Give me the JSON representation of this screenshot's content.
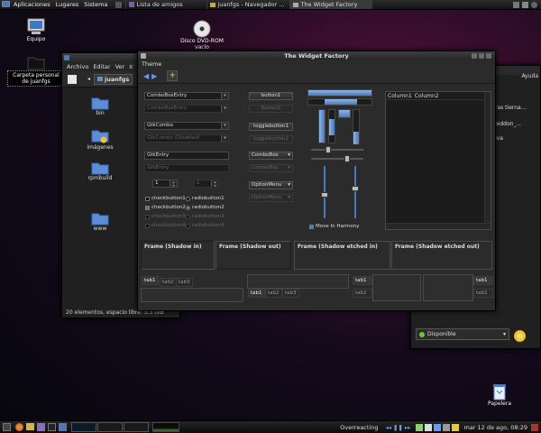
{
  "top_panel": {
    "menus": [
      "Aplicaciones",
      "Lugares",
      "Sistema"
    ],
    "tasks": [
      "Lista de amigos",
      "juanfgs - Navegador ...",
      "The Widget Factory"
    ]
  },
  "desktop": {
    "icons": [
      {
        "label": "Equipo"
      },
      {
        "label": "Carpeta personal de juanfgs"
      },
      {
        "label": "Disco DVD-ROM vacío"
      },
      {
        "label": "Papelera"
      }
    ]
  },
  "file_manager": {
    "menus": [
      "Archivo",
      "Editar",
      "Ver",
      "Ir"
    ],
    "location": "juanfgs",
    "folders": [
      "bin",
      "imágenes",
      "rpmbuild",
      "www"
    ],
    "status": "20 elementos, espacio libre: 5.3 GiB"
  },
  "widget_factory": {
    "title": "The Widget Factory",
    "menu": "Theme",
    "col1": {
      "combo_entry": "ComboBoxEntry",
      "combo_entry_disabled": "ComboBoxEntry",
      "gtk_combo": "GtkCombo",
      "gtk_combo_disabled": "GtkCombo (Disabled)",
      "entry": "GtkEntry",
      "entry_disabled": "GtkEntry",
      "spin": "1",
      "spin_disabled": "1",
      "check1": "checkbutton1",
      "check2": "checkbutton2",
      "check3": "checkbutton3",
      "check4": "checkbutton4",
      "radio1": "radiobutton1",
      "radio2": "radiobutton2",
      "radio3": "radiobutton3",
      "radio4": "radiobutton4"
    },
    "col2": {
      "button1": "button1",
      "button2": "button2",
      "toggle1": "togglebutton1",
      "toggle2": "togglebutton2",
      "combobox": "ComboBox",
      "combobox_disabled": "ComboBox",
      "option_menu": "OptionMenu",
      "option_menu_disabled": "OptionMenu"
    },
    "col3": {
      "move_in_harmony": "Move In Harmony",
      "move_in_harmony_checked": true,
      "scales": {
        "h_scale_1": 0.3,
        "h_scale_2": 0.72,
        "v_scale_1": 0.55,
        "v_scale_2": 0.42
      }
    },
    "list": {
      "columns": [
        "Column1",
        "Column2"
      ]
    },
    "frames": [
      "Frame (Shadow in)",
      "Frame (Shadow out)",
      "Frame (Shadow etched in)",
      "Frame (Shadow etched out)"
    ],
    "tabs": [
      "tab1",
      "tab2",
      "tab3"
    ]
  },
  "right_window": {
    "menu": "Ayuda",
    "items": [
      "ras tierna...",
      "jeddon_...",
      "iva"
    ],
    "status": "Disponible"
  },
  "bottom_panel": {
    "track": "Overreacting",
    "clock": "mar 12 de ago, 08:29"
  },
  "colors": {
    "accent": "#4a78b8",
    "titlebar": "#2e2e2e",
    "window_bg": "#2b2b2b"
  }
}
